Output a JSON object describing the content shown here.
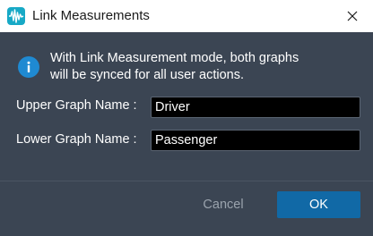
{
  "window": {
    "title": "Link Measurements",
    "app_icon": "waveform-icon",
    "close_icon": "close-icon"
  },
  "info": {
    "icon": "info-icon",
    "line1": "With Link Measurement mode, both graphs",
    "line2": "will be synced for all user actions."
  },
  "fields": {
    "upper": {
      "label": "Upper Graph Name :",
      "value": "Driver"
    },
    "lower": {
      "label": "Lower Graph Name :",
      "value": "Passenger"
    }
  },
  "buttons": {
    "cancel": "Cancel",
    "ok": "OK"
  },
  "colors": {
    "dialog_bg": "#3b4553",
    "accent": "#1169a6",
    "info_blue": "#1f8ad2",
    "app_icon_teal": "#17a9c6"
  }
}
